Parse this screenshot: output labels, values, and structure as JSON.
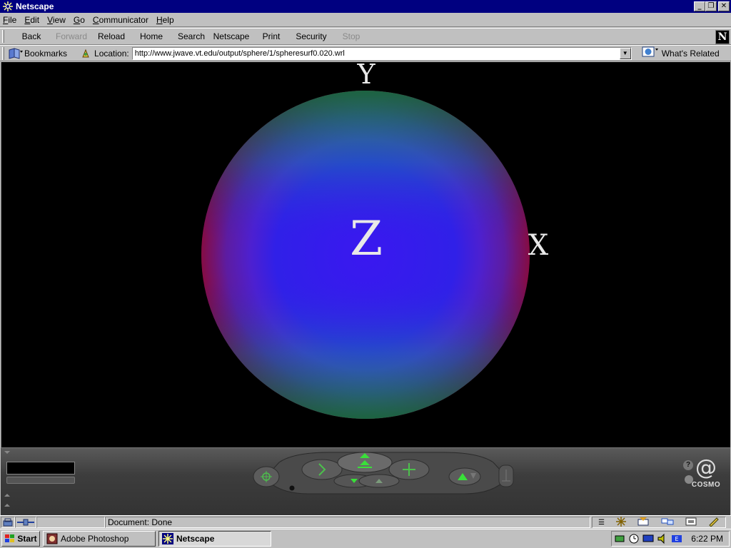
{
  "window": {
    "title": "Netscape"
  },
  "menu": {
    "items": [
      {
        "label": "File",
        "accel": "F",
        "rest": "ile"
      },
      {
        "label": "Edit",
        "accel": "E",
        "rest": "dit"
      },
      {
        "label": "View",
        "accel": "V",
        "rest": "iew"
      },
      {
        "label": "Go",
        "accel": "G",
        "rest": "o"
      },
      {
        "label": "Communicator",
        "accel": "C",
        "rest": "ommunicator"
      },
      {
        "label": "Help",
        "accel": "H",
        "rest": "elp"
      }
    ]
  },
  "toolbar": {
    "back": "Back",
    "forward": "Forward",
    "reload": "Reload",
    "home": "Home",
    "search": "Search",
    "netscape": "Netscape",
    "print": "Print",
    "security": "Security",
    "stop": "Stop",
    "logo": "N"
  },
  "location": {
    "bookmarks": "Bookmarks",
    "label": "Location:",
    "url": "http://www.jwave.vt.edu/output/sphere/1/spheresurf0.020.wrl",
    "related": "What's Related"
  },
  "scene": {
    "axis_y": "Y",
    "axis_z": "Z",
    "axis_x": "X",
    "colors": {
      "edge_green": "#1e8a55",
      "center_blue": "#3a18f0",
      "edge_magenta": "#b0105a"
    }
  },
  "cosmo": {
    "brand": "COSMO",
    "help": "?"
  },
  "status": {
    "text": "Document: Done"
  },
  "taskbar": {
    "start": "Start",
    "tasks": [
      "Adobe Photoshop",
      "Netscape"
    ],
    "clock": "6:22 PM"
  }
}
